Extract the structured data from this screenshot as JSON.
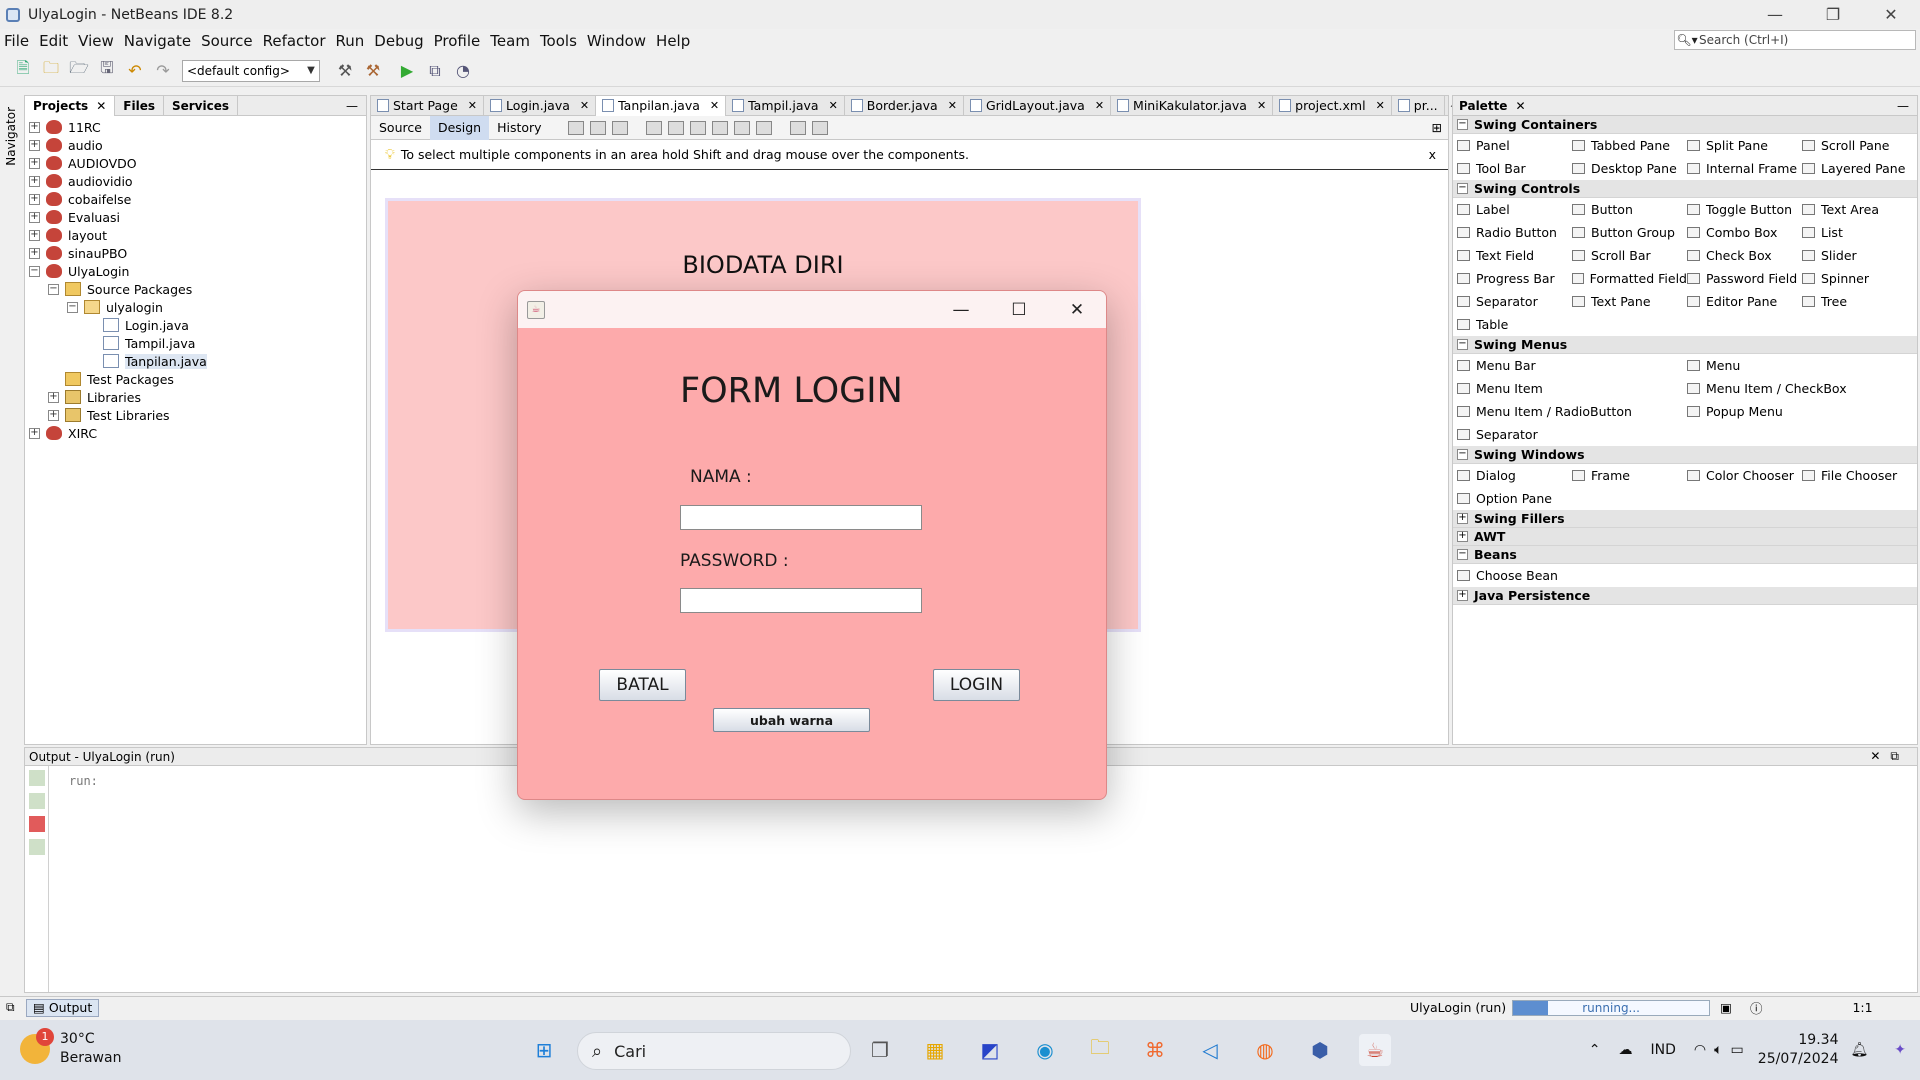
{
  "window": {
    "title": "UlyaLogin - NetBeans IDE 8.2"
  },
  "menu": [
    "File",
    "Edit",
    "View",
    "Navigate",
    "Source",
    "Refactor",
    "Run",
    "Debug",
    "Profile",
    "Team",
    "Tools",
    "Window",
    "Help"
  ],
  "search": {
    "placeholder": "Search (Ctrl+I)"
  },
  "toolbar": {
    "config": "<default config>"
  },
  "left_panel": {
    "tabs": [
      "Projects",
      "Files",
      "Services"
    ],
    "navigator_label": "Navigator",
    "tree": [
      {
        "label": "11RC",
        "level": 0,
        "expander": "+",
        "icon": "project"
      },
      {
        "label": "audio",
        "level": 0,
        "expander": "+",
        "icon": "project"
      },
      {
        "label": "AUDIOVDO",
        "level": 0,
        "expander": "+",
        "icon": "project"
      },
      {
        "label": "audiovidio",
        "level": 0,
        "expander": "+",
        "icon": "project"
      },
      {
        "label": "cobaifelse",
        "level": 0,
        "expander": "+",
        "icon": "project"
      },
      {
        "label": "Evaluasi",
        "level": 0,
        "expander": "+",
        "icon": "project"
      },
      {
        "label": "layout",
        "level": 0,
        "expander": "+",
        "icon": "project"
      },
      {
        "label": "sinauPBO",
        "level": 0,
        "expander": "+",
        "icon": "project"
      },
      {
        "label": "UlyaLogin",
        "level": 0,
        "expander": "-",
        "icon": "project"
      },
      {
        "label": "Source Packages",
        "level": 1,
        "expander": "-",
        "icon": "pkgs"
      },
      {
        "label": "ulyalogin",
        "level": 2,
        "expander": "-",
        "icon": "pkg"
      },
      {
        "label": "Login.java",
        "level": 3,
        "expander": "",
        "icon": "java"
      },
      {
        "label": "Tampil.java",
        "level": 3,
        "expander": "",
        "icon": "java"
      },
      {
        "label": "Tanpilan.java",
        "level": 3,
        "expander": "",
        "icon": "java",
        "selected": true
      },
      {
        "label": "Test Packages",
        "level": 1,
        "expander": "",
        "icon": "pkgs"
      },
      {
        "label": "Libraries",
        "level": 1,
        "expander": "+",
        "icon": "lib"
      },
      {
        "label": "Test Libraries",
        "level": 1,
        "expander": "+",
        "icon": "lib"
      },
      {
        "label": "XIRC",
        "level": 0,
        "expander": "+",
        "icon": "project"
      }
    ]
  },
  "editor": {
    "tabs": [
      {
        "label": "Start Page"
      },
      {
        "label": "Login.java"
      },
      {
        "label": "Tanpilan.java",
        "active": true
      },
      {
        "label": "Tampil.java"
      },
      {
        "label": "Border.java"
      },
      {
        "label": "GridLayout.java"
      },
      {
        "label": "MiniKakulator.java"
      },
      {
        "label": "project.xml"
      },
      {
        "label": "pr..."
      }
    ],
    "view_buttons": [
      "Source",
      "Design",
      "History"
    ],
    "active_view": "Design",
    "hint": "To select multiple components in an area hold Shift and drag mouse over the components.",
    "hint_close": "x",
    "form_heading": "BIODATA DIRI"
  },
  "palette": {
    "title": "Palette",
    "categories": [
      {
        "name": "Swing Containers",
        "expanded": true,
        "columns": 4,
        "items": [
          "Panel",
          "Tabbed Pane",
          "Split Pane",
          "Scroll Pane",
          "Tool Bar",
          "Desktop Pane",
          "Internal Frame",
          "Layered Pane"
        ]
      },
      {
        "name": "Swing Controls",
        "expanded": true,
        "columns": 4,
        "items": [
          "Label",
          "Button",
          "Toggle Button",
          "Text Area",
          "Radio Button",
          "Button Group",
          "Combo Box",
          "List",
          "Text Field",
          "Scroll Bar",
          "Check Box",
          "Slider",
          "Progress Bar",
          "Formatted Field",
          "Password Field",
          "Spinner",
          "Separator",
          "Text Pane",
          "Editor Pane",
          "Tree",
          "Table"
        ]
      },
      {
        "name": "Swing Menus",
        "expanded": true,
        "columns": 2,
        "items": [
          "Menu Bar",
          "Menu",
          "Menu Item",
          "Menu Item / CheckBox",
          "Menu Item / RadioButton",
          "Popup Menu",
          "Separator"
        ]
      },
      {
        "name": "Swing Windows",
        "expanded": true,
        "columns": 4,
        "items": [
          "Dialog",
          "Frame",
          "Color Chooser",
          "File Chooser",
          "Option Pane"
        ]
      },
      {
        "name": "Swing Fillers",
        "expanded": false,
        "columns": 4,
        "items": []
      },
      {
        "name": "AWT",
        "expanded": false,
        "columns": 4,
        "items": []
      },
      {
        "name": "Beans",
        "expanded": true,
        "columns": 4,
        "items": [
          "Choose Bean"
        ]
      },
      {
        "name": "Java Persistence",
        "expanded": false,
        "columns": 4,
        "items": []
      }
    ]
  },
  "output": {
    "title": "Output - UlyaLogin (run)",
    "text": "run:",
    "tab_label": "Output"
  },
  "status": {
    "task": "UlyaLogin (run)",
    "progress_text": "running...",
    "progress": 0.18,
    "position": "1:1"
  },
  "dialog": {
    "title": "FORM LOGIN",
    "nama_label": "NAMA :",
    "nama_value": "",
    "password_label": "PASSWORD :",
    "password_value": "",
    "batal_label": "BATAL",
    "login_label": "LOGIN",
    "warna_label": "ubah warna",
    "background": "#fdaaab"
  },
  "taskbar": {
    "weather_temp": "30°C",
    "weather_desc": "Berawan",
    "weather_badge": "1",
    "search_label": "Cari",
    "language": "IND",
    "time": "19.34",
    "date": "25/07/2024"
  },
  "colors": {
    "form_pink": "#fcc8c8",
    "dialog_pink": "#fdaaab",
    "selection": "#dde6f2"
  }
}
